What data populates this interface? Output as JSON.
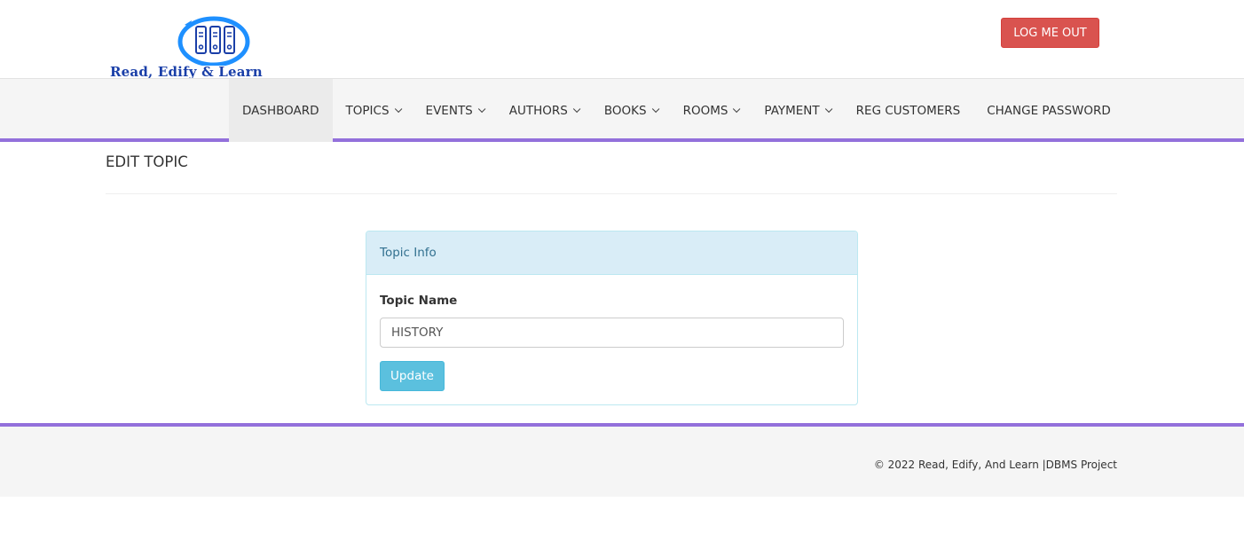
{
  "brand": {
    "logo_text": "Read, Edify & Learn",
    "logo_color": "#1a3fa8",
    "ring_color": "#1e90ff"
  },
  "header": {
    "logout_label": "LOG ME OUT"
  },
  "nav": {
    "items": [
      {
        "label": "DASHBOARD",
        "has_dropdown": false,
        "active": true
      },
      {
        "label": "TOPICS",
        "has_dropdown": true
      },
      {
        "label": "EVENTS",
        "has_dropdown": true
      },
      {
        "label": "AUTHORS",
        "has_dropdown": true
      },
      {
        "label": "BOOKS",
        "has_dropdown": true
      },
      {
        "label": "ROOMS",
        "has_dropdown": true
      },
      {
        "label": "PAYMENT",
        "has_dropdown": true
      },
      {
        "label": "REG CUSTOMERS",
        "has_dropdown": false
      },
      {
        "label": "CHANGE PASSWORD",
        "has_dropdown": false
      }
    ],
    "accent_color": "#9370db"
  },
  "page": {
    "title": "EDIT TOPIC"
  },
  "panel": {
    "heading": "Topic Info",
    "field_label": "Topic Name",
    "field_value": "HISTORY",
    "submit_label": "Update"
  },
  "footer": {
    "text": "© 2022 Read, Edify, And Learn |DBMS Project"
  },
  "colors": {
    "danger": "#d9534f",
    "info": "#5bc0de",
    "panel_heading_bg": "#d9edf7"
  }
}
